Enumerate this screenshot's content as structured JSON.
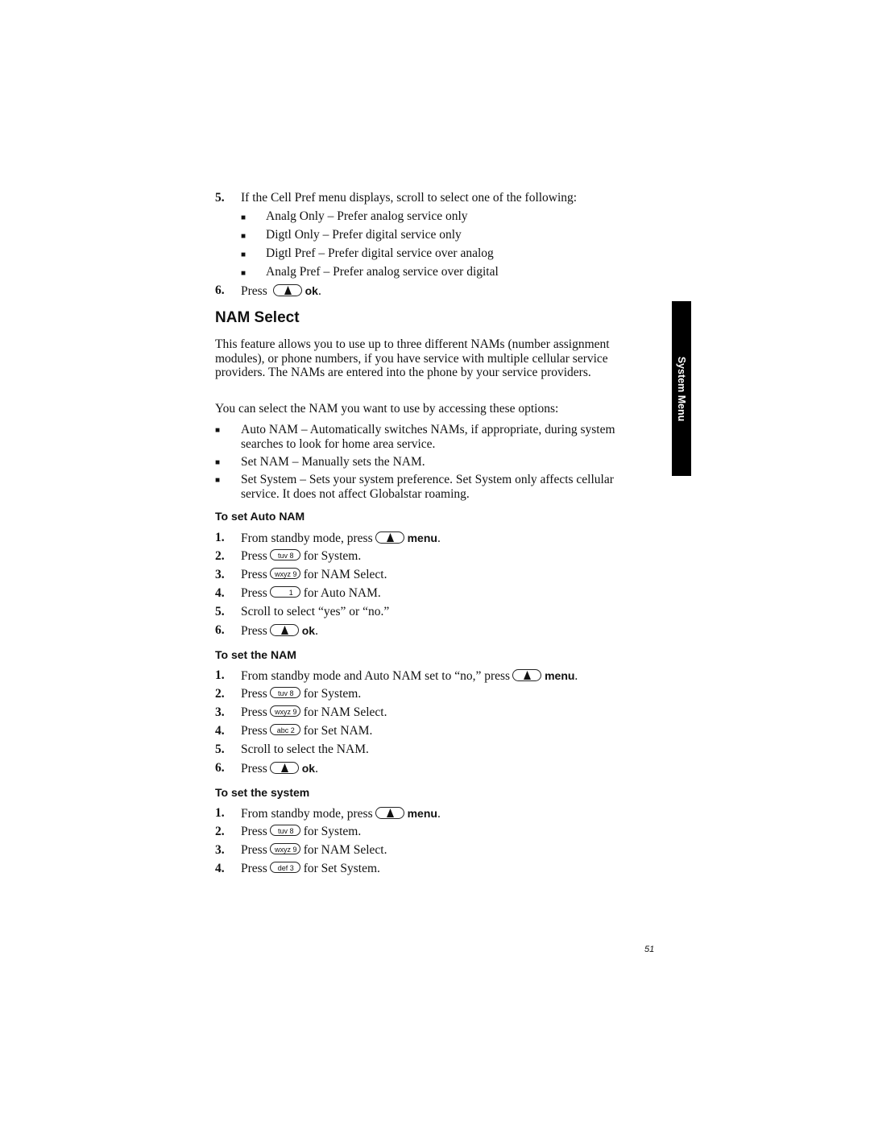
{
  "top_steps": [
    {
      "num": "5.",
      "text": "If the Cell Pref menu displays, scroll to select one of the following:"
    }
  ],
  "cell_pref_options": [
    "Analg Only – Prefer analog service only",
    "Digtl Only – Prefer digital service only",
    "Digtl Pref – Prefer digital service over analog",
    "Analg Pref – Prefer analog service over digital"
  ],
  "top_step_6": {
    "num": "6.",
    "pre": "Press",
    "key_label": "ok",
    "post": "."
  },
  "section_title": "NAM Select",
  "intro_paragraph": "This feature allows you to use up to three different NAMs (number assignment modules), or phone numbers, if you have service with multiple cellular service providers. The NAMs are entered into the phone by your service providers.",
  "options_intro": "You can select the NAM you want to use by accessing these options:",
  "nam_options": [
    "Auto NAM – Automatically switches NAMs, if appropriate, during system searches to look for home area service.",
    "Set NAM – Manually sets the NAM.",
    "Set System – Sets your system preference. Set System only affects cellular service. It does not affect Globalstar roaming."
  ],
  "bullet_glyph": "■",
  "subsections": [
    {
      "title": "To set Auto NAM",
      "steps": [
        {
          "num": "1.",
          "pre": "From standby mode, press",
          "key": "softkey",
          "key_text": "",
          "post": "",
          "bold": "menu",
          "end": "."
        },
        {
          "num": "2.",
          "pre": "Press",
          "key": "number",
          "key_text": "tuv 8",
          "post": "for System."
        },
        {
          "num": "3.",
          "pre": "Press",
          "key": "number",
          "key_text": "wxyz 9",
          "post": "for NAM Select."
        },
        {
          "num": "4.",
          "pre": "Press",
          "key": "number",
          "key_text": "1",
          "post": "for Auto NAM."
        },
        {
          "num": "5.",
          "pre": "Scroll to select “yes” or “no.”"
        },
        {
          "num": "6.",
          "pre": "Press",
          "key": "softkey",
          "key_text": "",
          "post": "",
          "bold": "ok",
          "end": "."
        }
      ]
    },
    {
      "title": "To set the NAM",
      "steps": [
        {
          "num": "1.",
          "pre": "From standby mode and Auto NAM set to “no,” press",
          "key": "softkey",
          "key_text": "",
          "post": "",
          "bold": "menu",
          "end": "."
        },
        {
          "num": "2.",
          "pre": "Press",
          "key": "number",
          "key_text": "tuv 8",
          "post": "for System."
        },
        {
          "num": "3.",
          "pre": "Press",
          "key": "number",
          "key_text": "wxyz 9",
          "post": "for NAM Select."
        },
        {
          "num": "4.",
          "pre": "Press",
          "key": "number",
          "key_text": "abc 2",
          "post": "for Set NAM."
        },
        {
          "num": "5.",
          "pre": "Scroll to select the NAM."
        },
        {
          "num": "6.",
          "pre": "Press",
          "key": "softkey",
          "key_text": "",
          "post": "",
          "bold": "ok",
          "end": "."
        }
      ]
    },
    {
      "title": "To set the system",
      "steps": [
        {
          "num": "1.",
          "pre": "From standby mode, press",
          "key": "softkey",
          "key_text": "",
          "post": "",
          "bold": "menu",
          "end": "."
        },
        {
          "num": "2.",
          "pre": "Press",
          "key": "number",
          "key_text": "tuv 8",
          "post": "for System."
        },
        {
          "num": "3.",
          "pre": "Press",
          "key": "number",
          "key_text": "wxyz 9",
          "post": "for NAM Select."
        },
        {
          "num": "4.",
          "pre": "Press",
          "key": "number",
          "key_text": "def 3",
          "post": "for Set System."
        }
      ]
    }
  ],
  "side_tab_label": "System Menu",
  "page_number": "51"
}
